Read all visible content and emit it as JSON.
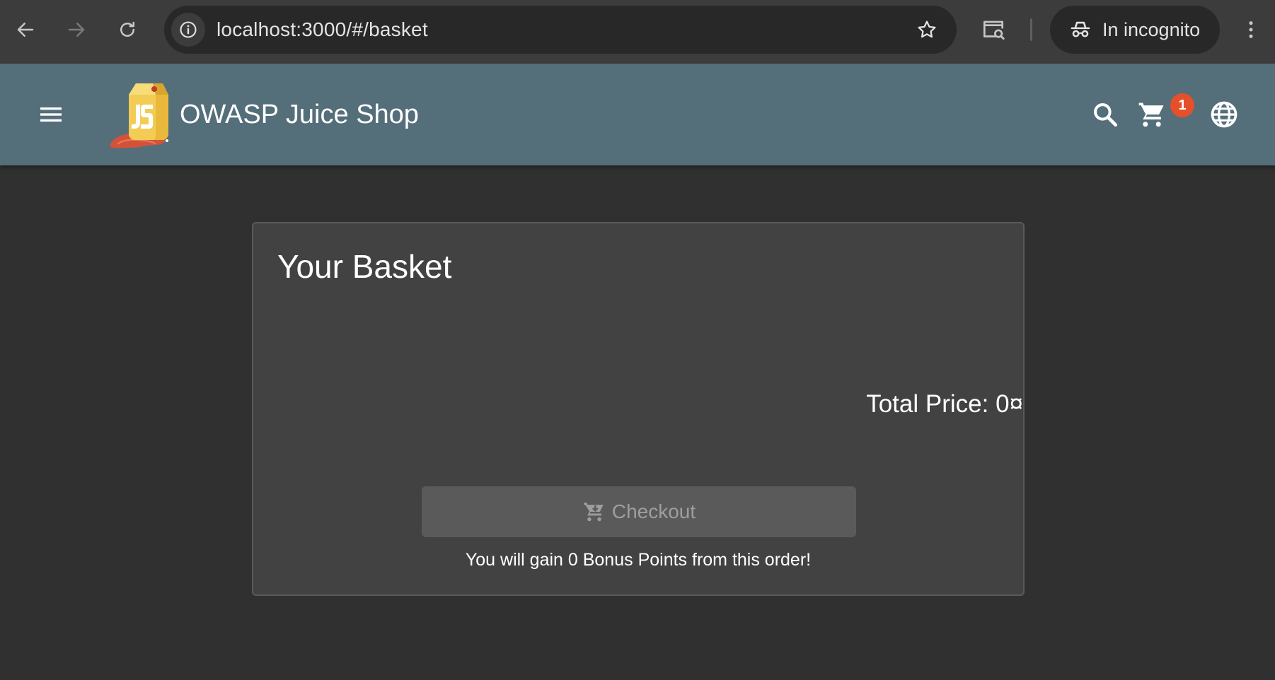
{
  "browser": {
    "url": "localhost:3000/#/basket",
    "incognito_label": "In incognito",
    "icons": {
      "back": "back-arrow-icon",
      "forward": "forward-arrow-icon",
      "reload": "reload-icon",
      "site_info": "info-icon",
      "bookmark": "star-icon",
      "lens": "search-page-icon",
      "incognito": "incognito-icon",
      "menu": "kebab-menu-icon"
    }
  },
  "app": {
    "title": "OWASP Juice Shop",
    "cart_count": "1",
    "toolbar_color": "#546e7a",
    "badge_color": "#e5502a",
    "icons": {
      "menu": "hamburger-menu-icon",
      "search": "search-icon",
      "cart": "shopping-cart-icon",
      "language": "globe-icon"
    }
  },
  "basket": {
    "title": "Your Basket",
    "total_price": "Total Price: 0¤",
    "checkout_label": "Checkout",
    "checkout_icon": "add-shopping-cart-icon",
    "bonus_text": "You will gain 0 Bonus Points from this order!"
  }
}
